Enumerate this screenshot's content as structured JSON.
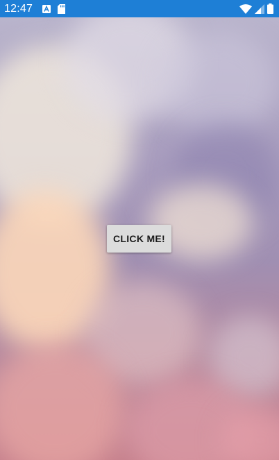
{
  "status_bar": {
    "time": "12:47",
    "background_color": "#1e7fd6",
    "left_icons": [
      "a-notification-icon",
      "sd-card-icon"
    ],
    "right_icons": [
      "wifi-icon",
      "cellular-signal-icon",
      "battery-icon"
    ]
  },
  "main": {
    "background": "cloudy-sky-wallpaper",
    "button_label": "CLICK ME!"
  }
}
